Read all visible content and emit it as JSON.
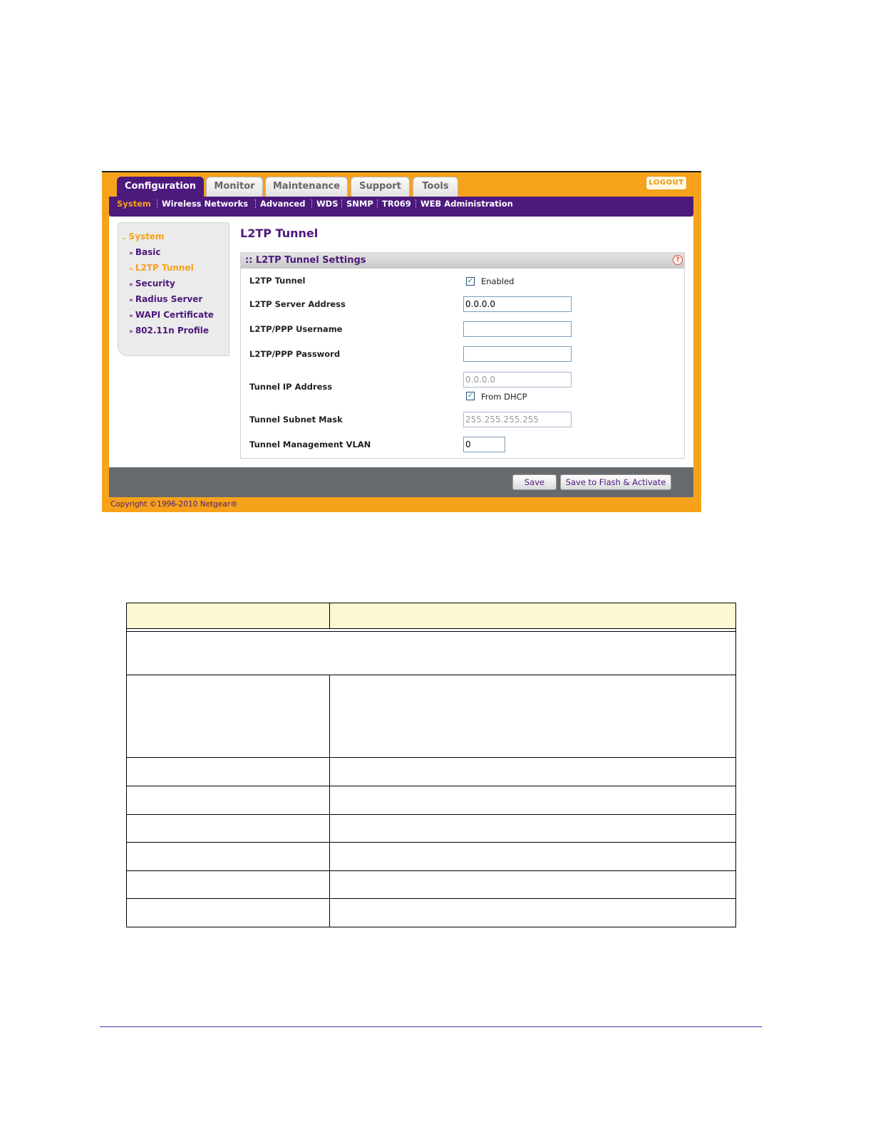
{
  "tabs": [
    {
      "label": "Configuration",
      "active": true
    },
    {
      "label": "Monitor",
      "active": false
    },
    {
      "label": "Maintenance",
      "active": false
    },
    {
      "label": "Support",
      "active": false
    },
    {
      "label": "Tools",
      "active": false
    }
  ],
  "logout_label": "LOGOUT",
  "subnav": [
    {
      "label": "System",
      "active": true
    },
    {
      "label": "Wireless Networks",
      "active": false
    },
    {
      "label": "Advanced",
      "active": false
    },
    {
      "label": "WDS",
      "active": false
    },
    {
      "label": "SNMP",
      "active": false
    },
    {
      "label": "TR069",
      "active": false
    },
    {
      "label": "WEB Administration",
      "active": false
    }
  ],
  "sidebar": {
    "group_label": "System",
    "items": [
      {
        "label": "Basic",
        "active": false
      },
      {
        "label": "L2TP Tunnel",
        "active": true
      },
      {
        "label": "Security",
        "active": false
      },
      {
        "label": "Radius Server",
        "active": false
      },
      {
        "label": "WAPI Certificate",
        "active": false
      },
      {
        "label": "802.11n Profile",
        "active": false
      }
    ]
  },
  "page_title": "L2TP Tunnel",
  "panel": {
    "title": ":: L2TP Tunnel Settings",
    "help_icon": "?",
    "fields": {
      "tunnel": {
        "label": "L2TP Tunnel",
        "checkbox_label": "Enabled",
        "checked": true
      },
      "server_address": {
        "label": "L2TP Server Address",
        "value": "0.0.0.0"
      },
      "username": {
        "label": "L2TP/PPP Username",
        "value": ""
      },
      "password": {
        "label": "L2TP/PPP Password",
        "value": ""
      },
      "tunnel_ip": {
        "label": "Tunnel IP Address",
        "value": "0.0.0.0",
        "checkbox_label": "From DHCP",
        "checked": true
      },
      "subnet_mask": {
        "label": "Tunnel Subnet Mask",
        "value": "255.255.255.255"
      },
      "mgmt_vlan": {
        "label": "Tunnel Management VLAN",
        "value": "0"
      }
    }
  },
  "buttons": {
    "save": "Save",
    "save_flash": "Save to Flash & Activate"
  },
  "copyright": "Copyright ©1996-2010 Netgear®",
  "colors": {
    "orange": "#f7a21b",
    "purple": "#4c197d",
    "gray_bar": "#666a6c",
    "table_header": "#fcf9d2"
  }
}
